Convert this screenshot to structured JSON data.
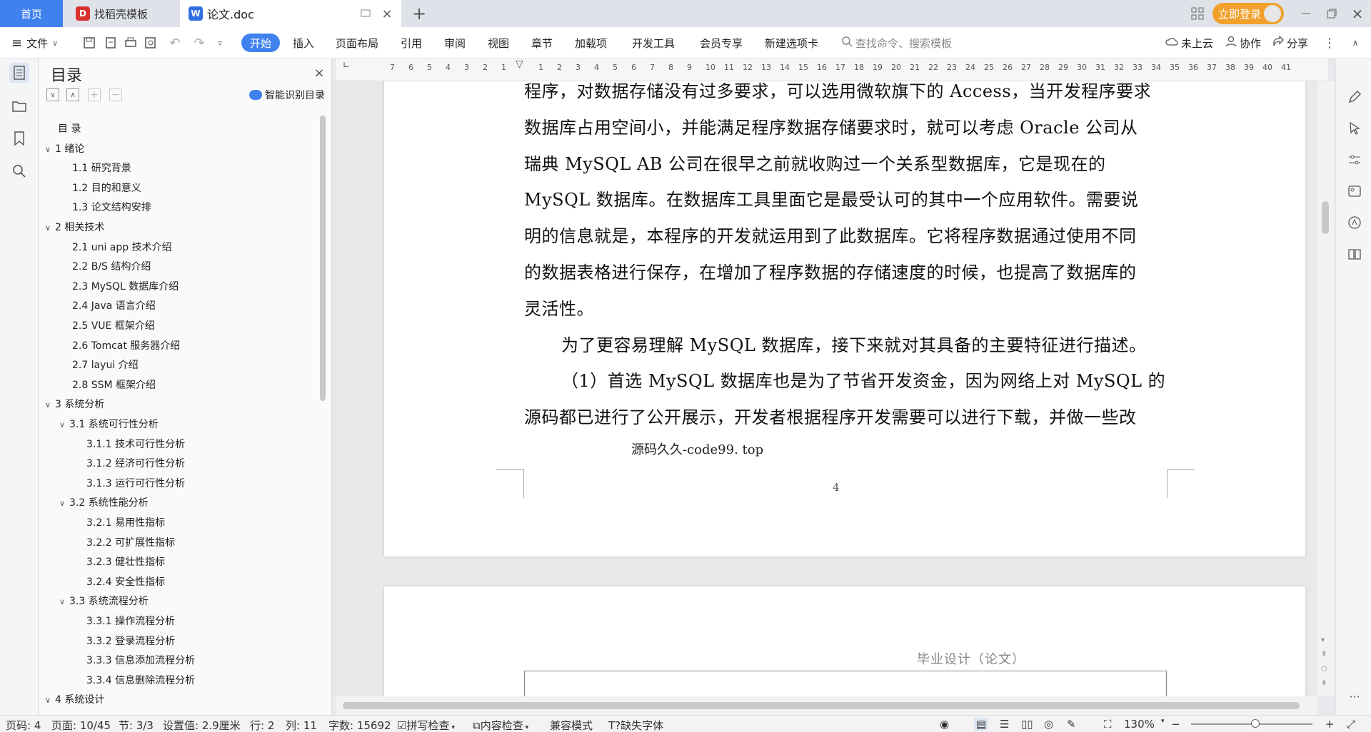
{
  "tabs": {
    "home": "首页",
    "template": "找稻壳模板",
    "doc": "论文.doc",
    "add": "+"
  },
  "titlebar": {
    "login": "立即登录"
  },
  "toolbar": {
    "file": "文件",
    "menu": [
      "开始",
      "插入",
      "页面布局",
      "引用",
      "审阅",
      "视图",
      "章节",
      "加载项",
      "开发工具",
      "会员专享",
      "新建选项卡"
    ],
    "search_placeholder": "查找命令、搜索模板",
    "cloud": "未上云",
    "collab": "协作",
    "share": "分享"
  },
  "toc": {
    "title": "目录",
    "smart": "智能识别目录",
    "items": [
      {
        "label": "目 录",
        "level": 0,
        "chev": ""
      },
      {
        "label": "1 绪论",
        "level": 0,
        "chev": "v"
      },
      {
        "label": "1.1 研究背景",
        "level": 1,
        "chev": ""
      },
      {
        "label": "1.2 目的和意义",
        "level": 1,
        "chev": ""
      },
      {
        "label": "1.3 论文结构安排",
        "level": 1,
        "chev": ""
      },
      {
        "label": "2 相关技术",
        "level": 0,
        "chev": "v"
      },
      {
        "label": "2.1 uni app 技术介绍",
        "level": 1,
        "chev": ""
      },
      {
        "label": "2.2 B/S 结构介绍",
        "level": 1,
        "chev": ""
      },
      {
        "label": "2.3 MySQL 数据库介绍",
        "level": 1,
        "chev": ""
      },
      {
        "label": "2.4 Java 语言介绍",
        "level": 1,
        "chev": ""
      },
      {
        "label": "2.5 VUE 框架介绍",
        "level": 1,
        "chev": ""
      },
      {
        "label": "2.6 Tomcat 服务器介绍",
        "level": 1,
        "chev": ""
      },
      {
        "label": "2.7 layui 介绍",
        "level": 1,
        "chev": ""
      },
      {
        "label": "2.8 SSM 框架介绍",
        "level": 1,
        "chev": ""
      },
      {
        "label": "3 系统分析",
        "level": 0,
        "chev": "v"
      },
      {
        "label": "3.1 系统可行性分析",
        "level": 1,
        "chev": "v"
      },
      {
        "label": "3.1.1 技术可行性分析",
        "level": 2,
        "chev": ""
      },
      {
        "label": "3.1.2 经济可行性分析",
        "level": 2,
        "chev": ""
      },
      {
        "label": "3.1.3 运行可行性分析",
        "level": 2,
        "chev": ""
      },
      {
        "label": "3.2 系统性能分析",
        "level": 1,
        "chev": "v"
      },
      {
        "label": "3.2.1 易用性指标",
        "level": 2,
        "chev": ""
      },
      {
        "label": "3.2.2 可扩展性指标",
        "level": 2,
        "chev": ""
      },
      {
        "label": "3.2.3 健壮性指标",
        "level": 2,
        "chev": ""
      },
      {
        "label": "3.2.4 安全性指标",
        "level": 2,
        "chev": ""
      },
      {
        "label": "3.3 系统流程分析",
        "level": 1,
        "chev": "v"
      },
      {
        "label": "3.3.1 操作流程分析",
        "level": 2,
        "chev": ""
      },
      {
        "label": "3.3.2 登录流程分析",
        "level": 2,
        "chev": ""
      },
      {
        "label": "3.3.3 信息添加流程分析",
        "level": 2,
        "chev": ""
      },
      {
        "label": "3.3.4 信息删除流程分析",
        "level": 2,
        "chev": ""
      },
      {
        "label": "4 系统设计",
        "level": 0,
        "chev": "v"
      }
    ]
  },
  "ruler": [
    "7",
    "6",
    "5",
    "4",
    "3",
    "2",
    "1",
    "",
    "1",
    "2",
    "3",
    "4",
    "5",
    "6",
    "7",
    "8",
    "9",
    "10",
    "11",
    "12",
    "13",
    "14",
    "15",
    "16",
    "17",
    "18",
    "19",
    "20",
    "21",
    "22",
    "23",
    "24",
    "25",
    "26",
    "27",
    "28",
    "29",
    "30",
    "31",
    "32",
    "33",
    "34",
    "35",
    "36",
    "37",
    "38",
    "39",
    "40",
    "41"
  ],
  "document": {
    "lines": [
      "程序，对数据存储没有过多要求，可以选用微软旗下的 Access，当开发程序要求",
      "数据库占用空间小，并能满足程序数据存储要求时，就可以考虑 Oracle 公司从",
      "瑞典 MySQL AB 公司在很早之前就收购过一个关系型数据库，它是现在的",
      "MySQL 数据库。在数据库工具里面它是最受认可的其中一个应用软件。需要说",
      "明的信息就是，本程序的开发就运用到了此数据库。它将程序数据通过使用不同",
      "的数据表格进行保存，在增加了程序数据的存储速度的时候，也提高了数据库的",
      "灵活性。",
      "为了更容易理解 MySQL 数据库，接下来就对其具备的主要特征进行描述。",
      "（1）首选 MySQL 数据库也是为了节省开发资金，因为网络上对 MySQL 的",
      "源码都已进行了公开展示，开发者根据程序开发需要可以进行下载，并做一些改"
    ],
    "watermark": "源码久久-code99. top",
    "page_number": "4",
    "next_header": "毕业设计（论文）"
  },
  "status": {
    "page": "页码: 4",
    "pages": "页面: 10/45",
    "section": "节: 3/3",
    "setting": "设置值: 2.9厘米",
    "row": "行: 2",
    "col": "列: 11",
    "words": "字数: 15692",
    "spell": "拼写检查",
    "content": "内容检查",
    "compat": "兼容模式",
    "missing_font": "缺失字体",
    "zoom": "130%"
  }
}
